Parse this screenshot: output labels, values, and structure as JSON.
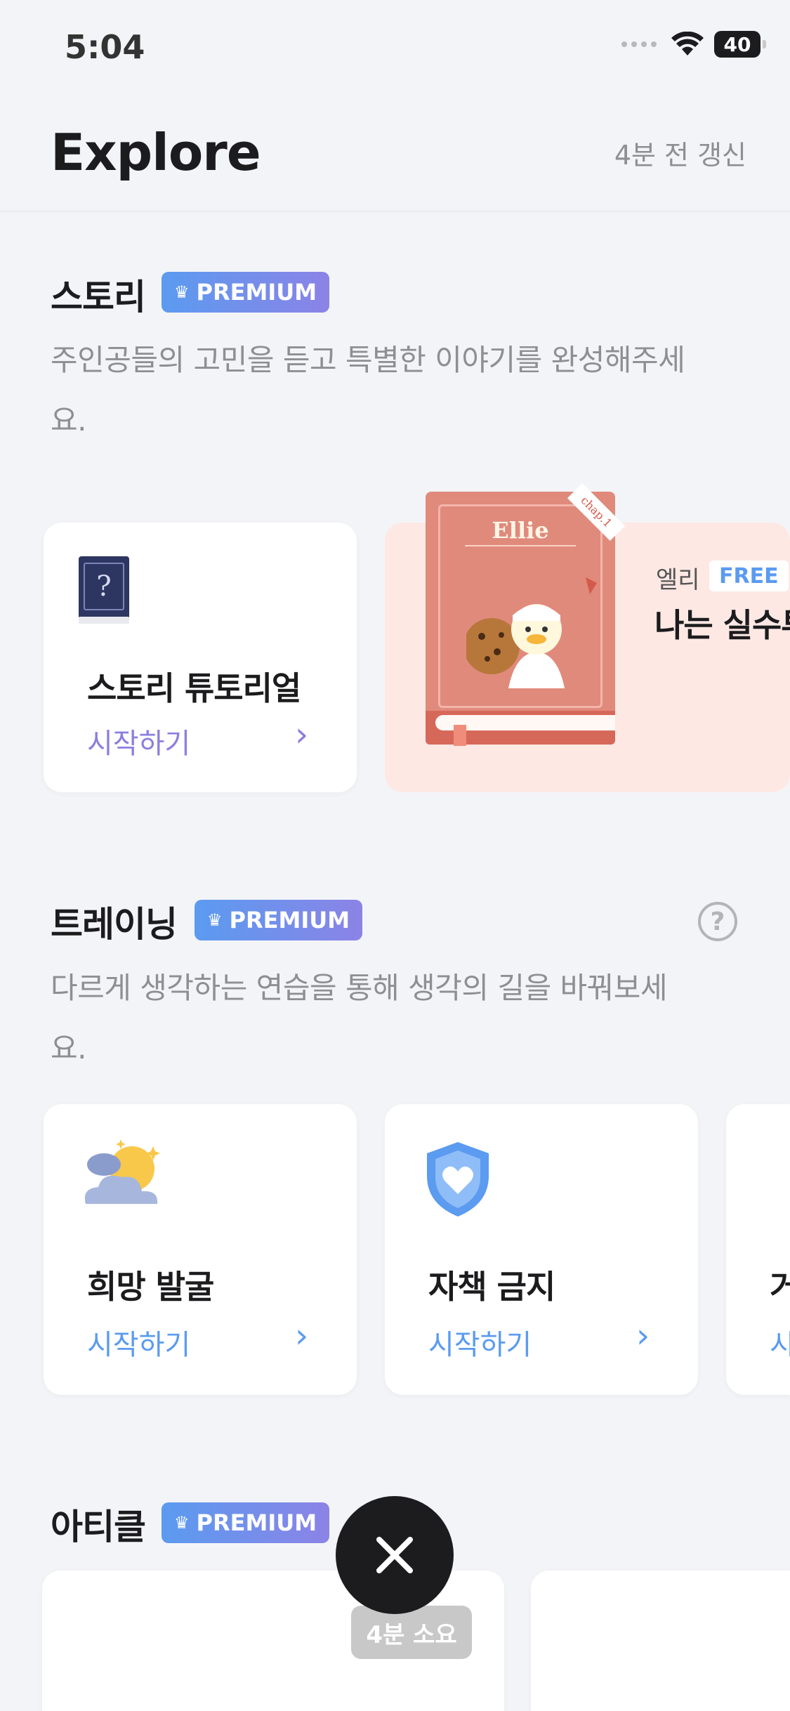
{
  "status_bar": {
    "time": "5:04",
    "battery": "40"
  },
  "header": {
    "title": "Explore",
    "updated": "4분 전 갱신"
  },
  "story": {
    "title": "스토리",
    "badge": "PREMIUM",
    "description_line1": "주인공들의 고민을 듣고 특별한 이야기를 완성해주세",
    "description_line2": "요.",
    "cards": [
      {
        "title": "스토리 튜토리얼",
        "link": "시작하기",
        "icon": "question-book-icon"
      },
      {
        "book_cover_title": "Ellie",
        "ribbon": "chap.1",
        "character": "엘리",
        "tag": "FREE",
        "title": "나는 실수투"
      }
    ]
  },
  "training": {
    "title": "트레이닝",
    "badge": "PREMIUM",
    "description_line1": "다르게 생각하는 연습을 통해 생각의 길을 바꿔보세",
    "description_line2": "요.",
    "cards": [
      {
        "title": "희망 발굴",
        "link": "시작하기",
        "icon": "weather-icon"
      },
      {
        "title": "자책 금지",
        "link": "시작하기",
        "icon": "heart-shield-icon"
      },
      {
        "title": "거",
        "link": "시"
      }
    ]
  },
  "article": {
    "title": "아티클",
    "badge": "PREMIUM",
    "duration": "4분 소요"
  },
  "colors": {
    "accent_purple": "#8b7fe0",
    "accent_blue": "#5b9bf0",
    "background": "#f3f4f7",
    "story_card_bg": "#fde8e4"
  }
}
